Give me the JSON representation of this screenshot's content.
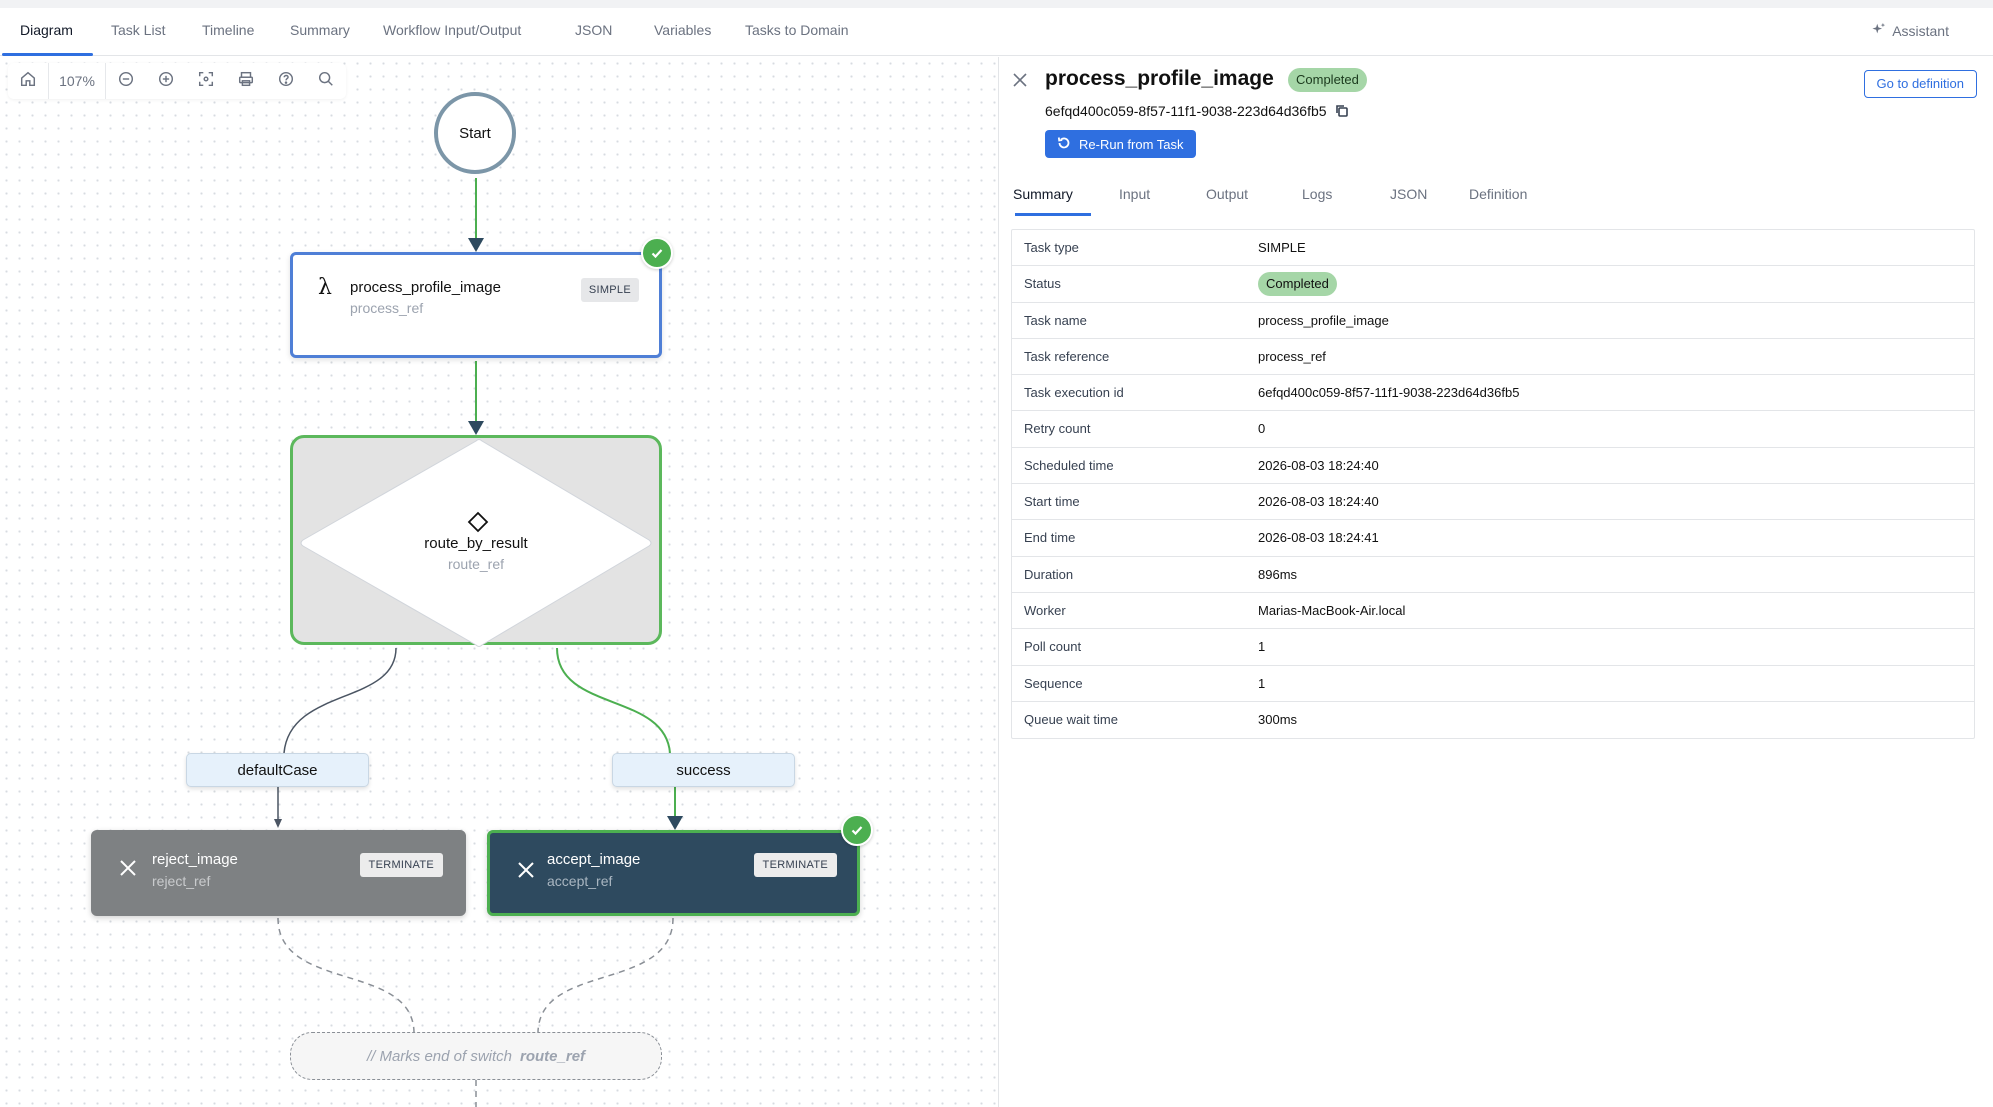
{
  "main_tabs": [
    {
      "label": "Diagram"
    },
    {
      "label": "Task List"
    },
    {
      "label": "Timeline"
    },
    {
      "label": "Summary"
    },
    {
      "label": "Workflow Input/Output"
    },
    {
      "label": "JSON"
    },
    {
      "label": "Variables"
    },
    {
      "label": "Tasks to Domain"
    }
  ],
  "assistant_label": "Assistant",
  "toolbar": {
    "zoom": "107%"
  },
  "diagram": {
    "start_label": "Start",
    "process": {
      "title": "process_profile_image",
      "ref": "process_ref",
      "badge": "SIMPLE"
    },
    "switch": {
      "title": "route_by_result",
      "ref": "route_ref"
    },
    "cases": {
      "default": "defaultCase",
      "success": "success"
    },
    "reject": {
      "title": "reject_image",
      "ref": "reject_ref",
      "badge": "TERMINATE"
    },
    "accept": {
      "title": "accept_image",
      "ref": "accept_ref",
      "badge": "TERMINATE"
    },
    "end_switch": {
      "prefix": "// Marks end of switch",
      "ref": "route_ref"
    }
  },
  "panel": {
    "title": "process_profile_image",
    "status": "Completed",
    "execution_id": "6efqd400c059-8f57-11f1-9038-223d64d36fb5",
    "goto_label": "Go to definition",
    "rerun_label": "Re-Run from Task",
    "tabs": [
      {
        "label": "Summary"
      },
      {
        "label": "Input"
      },
      {
        "label": "Output"
      },
      {
        "label": "Logs"
      },
      {
        "label": "JSON"
      },
      {
        "label": "Definition"
      }
    ],
    "rows": [
      {
        "key": "Task type",
        "value": "SIMPLE"
      },
      {
        "key": "Status",
        "value": "Completed"
      },
      {
        "key": "Task name",
        "value": "process_profile_image"
      },
      {
        "key": "Task reference",
        "value": "process_ref"
      },
      {
        "key": "Task execution id",
        "value": "6efqd400c059-8f57-11f1-9038-223d64d36fb5"
      },
      {
        "key": "Retry count",
        "value": "0"
      },
      {
        "key": "Scheduled time",
        "value": "2026-08-03 18:24:40"
      },
      {
        "key": "Start time",
        "value": "2026-08-03 18:24:40"
      },
      {
        "key": "End time",
        "value": "2026-08-03 18:24:41"
      },
      {
        "key": "Duration",
        "value": "896ms"
      },
      {
        "key": "Worker",
        "value": "Marias-MacBook-Air.local"
      },
      {
        "key": "Poll count",
        "value": "1"
      },
      {
        "key": "Sequence",
        "value": "1"
      },
      {
        "key": "Queue wait time",
        "value": "300ms"
      }
    ]
  },
  "colors": {
    "accent": "#2f6fe0",
    "success": "#4caf50",
    "completed_pill": "#a5d6a7",
    "accept_card": "#2e4a5f",
    "reject_card": "#7e8183"
  }
}
